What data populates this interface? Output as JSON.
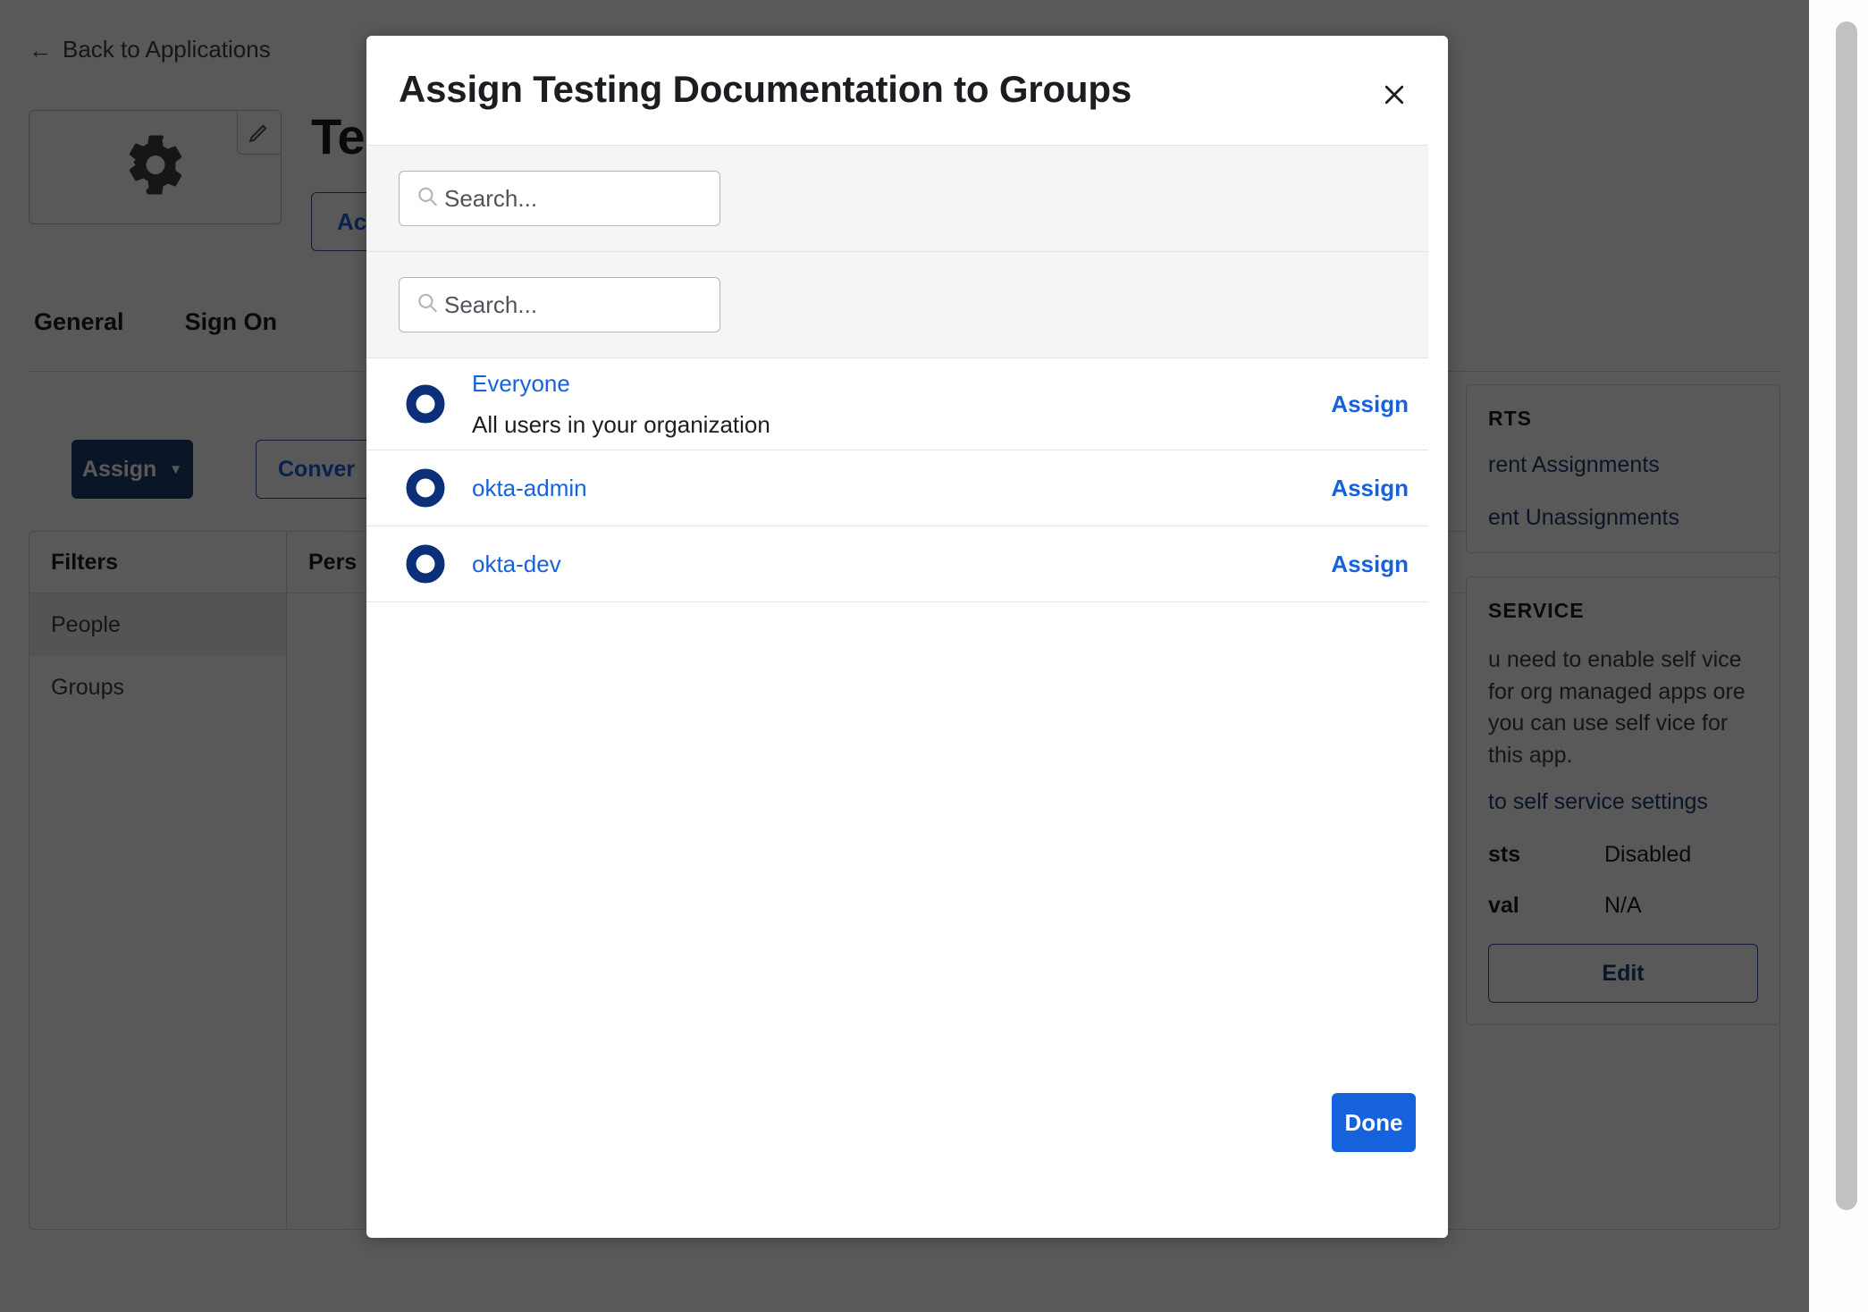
{
  "background": {
    "back_link": "Back to Applications",
    "back_arrow": "←",
    "app_icon": "gear-icon",
    "edit_icon": "pencil-icon",
    "app_title": "Te",
    "active_button": "Ac",
    "tabs": [
      {
        "label": "General"
      },
      {
        "label": "Sign On"
      }
    ],
    "assign_button": "Assign",
    "assign_caret": "▼",
    "convert_button": "Conver",
    "filters": {
      "heading": "Filters",
      "items": [
        {
          "label": "People",
          "selected": true
        },
        {
          "label": "Groups",
          "selected": false
        }
      ]
    },
    "people_column_heading": "Pers",
    "right_rail": {
      "reports_title": "RTS",
      "reports_links": [
        "rent Assignments",
        "ent Unassignments"
      ],
      "self_service_title": "SERVICE",
      "self_service_text": "u need to enable self vice for org managed apps ore you can use self vice for this app.",
      "self_service_link": "to self service settings",
      "rows": [
        {
          "label": "sts",
          "value": "Disabled"
        },
        {
          "label": "val",
          "value": "N/A"
        }
      ],
      "edit_button": "Edit"
    }
  },
  "modal": {
    "title": "Assign Testing Documentation to Groups",
    "close_label": "✕",
    "search_primary": {
      "value": "",
      "placeholder": "Search...",
      "icon": "search-icon"
    },
    "search_secondary": {
      "value": "",
      "placeholder": "Search...",
      "icon": "search-icon"
    },
    "groups": [
      {
        "name": "Everyone",
        "description": "All users in your organization",
        "action": "Assign",
        "icon": "group-ring-icon"
      },
      {
        "name": "okta-admin",
        "description": "",
        "action": "Assign",
        "icon": "group-ring-icon"
      },
      {
        "name": "okta-dev",
        "description": "",
        "action": "Assign",
        "icon": "group-ring-icon"
      }
    ],
    "done_button": "Done"
  },
  "colors": {
    "link_blue": "#1662dd",
    "primary_blue": "#1662dd",
    "navy": "#1d3c72",
    "group_icon_navy": "#0b2f78",
    "overlay": "#000000",
    "panel_border": "#d7d7d7"
  }
}
